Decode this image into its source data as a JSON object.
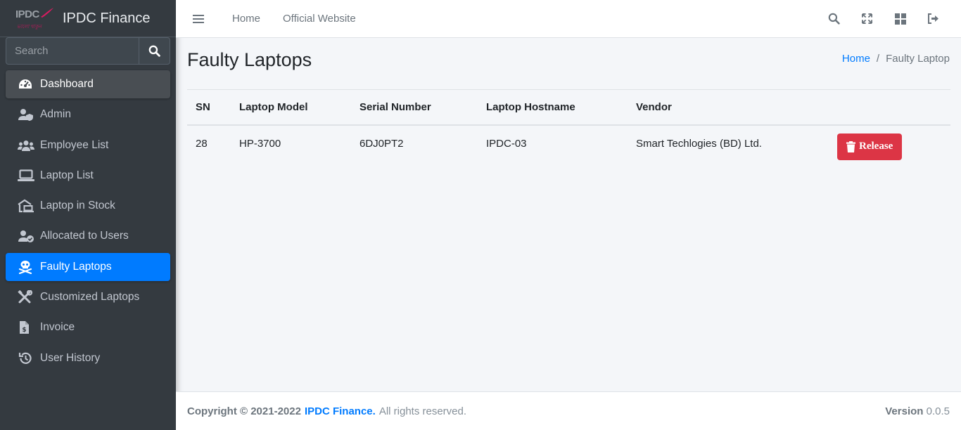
{
  "brand": {
    "logo_text": "IPDC",
    "logo_tag": "ভালো থাকুন",
    "name": "IPDC Finance"
  },
  "search": {
    "placeholder": "Search"
  },
  "sidebar": {
    "items": [
      {
        "label": "Dashboard",
        "icon": "tachometer-icon"
      },
      {
        "label": "Admin",
        "icon": "user-shield-icon"
      },
      {
        "label": "Employee List",
        "icon": "users-icon"
      },
      {
        "label": "Laptop List",
        "icon": "laptop-icon"
      },
      {
        "label": "Laptop in Stock",
        "icon": "warehouse-laptop-icon"
      },
      {
        "label": "Allocated to Users",
        "icon": "user-check-icon"
      },
      {
        "label": "Faulty Laptops",
        "icon": "skull-crossbones-icon"
      },
      {
        "label": "Customized Laptops",
        "icon": "tools-icon"
      },
      {
        "label": "Invoice",
        "icon": "file-invoice-icon"
      },
      {
        "label": "User History",
        "icon": "history-icon"
      }
    ]
  },
  "topbar": {
    "links": [
      "Home",
      "Official Website"
    ],
    "icons": [
      "search-icon",
      "expand-icon",
      "grid-icon",
      "logout-icon"
    ]
  },
  "page": {
    "title": "Faulty Laptops",
    "breadcrumb": {
      "home": "Home",
      "sep": "/",
      "current": "Faulty Laptop"
    }
  },
  "table": {
    "headers": [
      "SN",
      "Laptop Model",
      "Serial Number",
      "Laptop Hostname",
      "Vendor",
      ""
    ],
    "rows": [
      {
        "sn": "28",
        "model": "HP-3700",
        "serial": "6DJ0PT2",
        "hostname": "IPDC-03",
        "vendor": "Smart Techlogies (BD) Ltd.",
        "action": "Release"
      }
    ]
  },
  "footer": {
    "copyright": "Copyright © 2021-2022",
    "brand": "IPDC Finance.",
    "rights": "All rights reserved.",
    "version_label": "Version",
    "version": "0.0.5"
  },
  "colors": {
    "sidebar": "#343a40",
    "primary": "#007bff",
    "danger": "#dc3545"
  }
}
